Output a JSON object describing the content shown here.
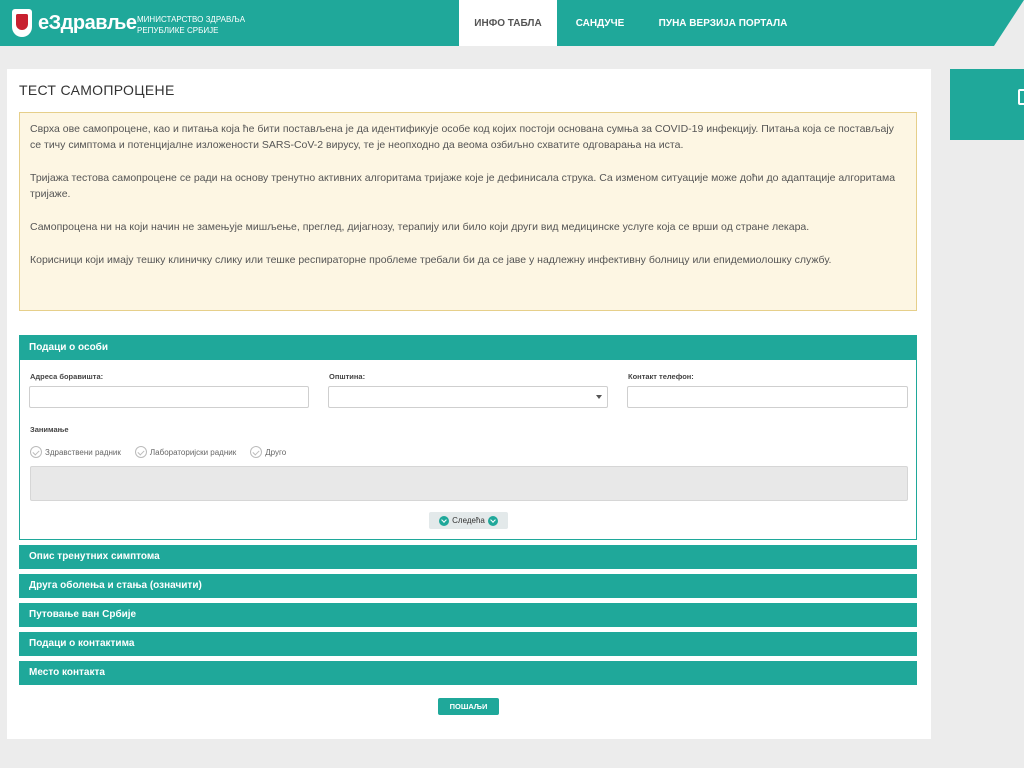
{
  "header": {
    "logo_text": "eЗдравље",
    "ministry_line1": "МИНИСТАРСТВО ЗДРАВЉА",
    "ministry_line2": "РЕПУБЛИКЕ СРБИЈЕ",
    "nav": [
      {
        "label": "ИНФО ТАБЛА",
        "active": true
      },
      {
        "label": "САНДУЧЕ",
        "active": false
      },
      {
        "label": "ПУНА ВЕРЗИЈА ПОРТАЛА",
        "active": false
      }
    ]
  },
  "page": {
    "title": "ТЕСТ САМОПРОЦЕНЕ"
  },
  "info": [
    "Сврха ове самопроцене, као и питања која ће бити постављена је да идентификује особе код којих постоји основана сумња за COVID-19 инфекцију. Питања која се постављају се тичу симптома и потенцијалне изложености SARS-CoV-2 вирусу, те је неопходно да веома озбиљно схватите одговарања на иста.",
    "Тријажа тестова самопроцене се ради на основу тренутно активних алгоритама тријаже које је дефинисала струка. Са изменом ситуације може доћи до адаптације алгоритама тријаже.",
    "Самопроцена ни на који начин не замењује мишљење, преглед, дијагнозу, терапију или било који други вид медицинске услуге која се врши од стране лекара.",
    "Корисници који имају тешку клиничку слику или тешке респираторне проблеме требали би да се јаве у надлежну инфективну болницу или епидемиолошку службу."
  ],
  "person_section": {
    "header": "Подаци о особи",
    "address_label": "Адреса боравишта:",
    "municipality_label": "Општина:",
    "phone_label": "Контакт телефон:",
    "occupation_label": "Занимање",
    "options": [
      "Здравствени радник",
      "Лабораторијски радник",
      "Друго"
    ],
    "next_label": "Следећа"
  },
  "sections": [
    "Опис тренутних симптома",
    "Друга оболења и стања (означити)",
    "Путовање ван Србије",
    "Подаци о контактима",
    "Место контакта"
  ],
  "submit_label": "ПОШАЉИ"
}
